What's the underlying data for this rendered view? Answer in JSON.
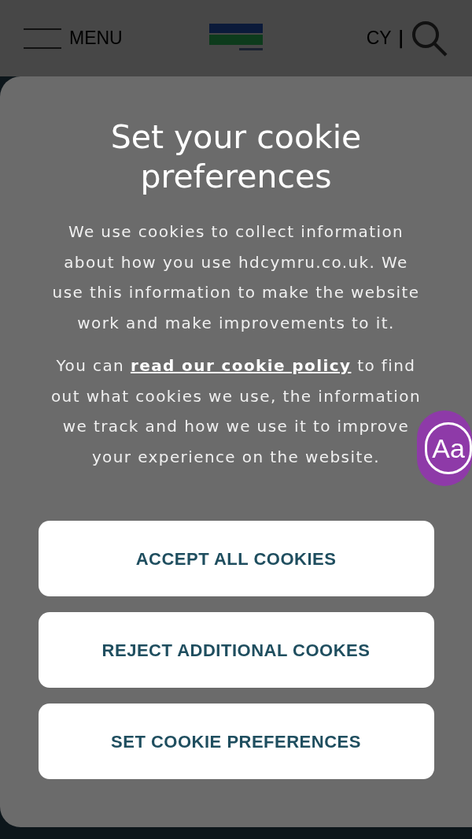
{
  "header": {
    "menu_label": "MENU",
    "language": "CY",
    "separator": "|"
  },
  "dialog": {
    "title": "Set your cookie preferences",
    "paragraphs": [
      {
        "parts": [
          {
            "text": "We use cookies to collect information about how you use hdcymru.co.uk. We use this information to make the website work and make improvements to it."
          }
        ]
      },
      {
        "parts": [
          {
            "text": "You can "
          },
          {
            "text": "read our cookie policy",
            "kind": "link"
          },
          {
            "text": " to find out what cookies we use, the information we track and how we use it to improve your experience on the website."
          }
        ]
      }
    ],
    "buttons": [
      "ACCEPT ALL COOKIES",
      "REJECT ADDITIONAL COOKES",
      "SET COOKIE PREFERENCES"
    ]
  },
  "accessibility_badge": {
    "label": "Aa"
  }
}
